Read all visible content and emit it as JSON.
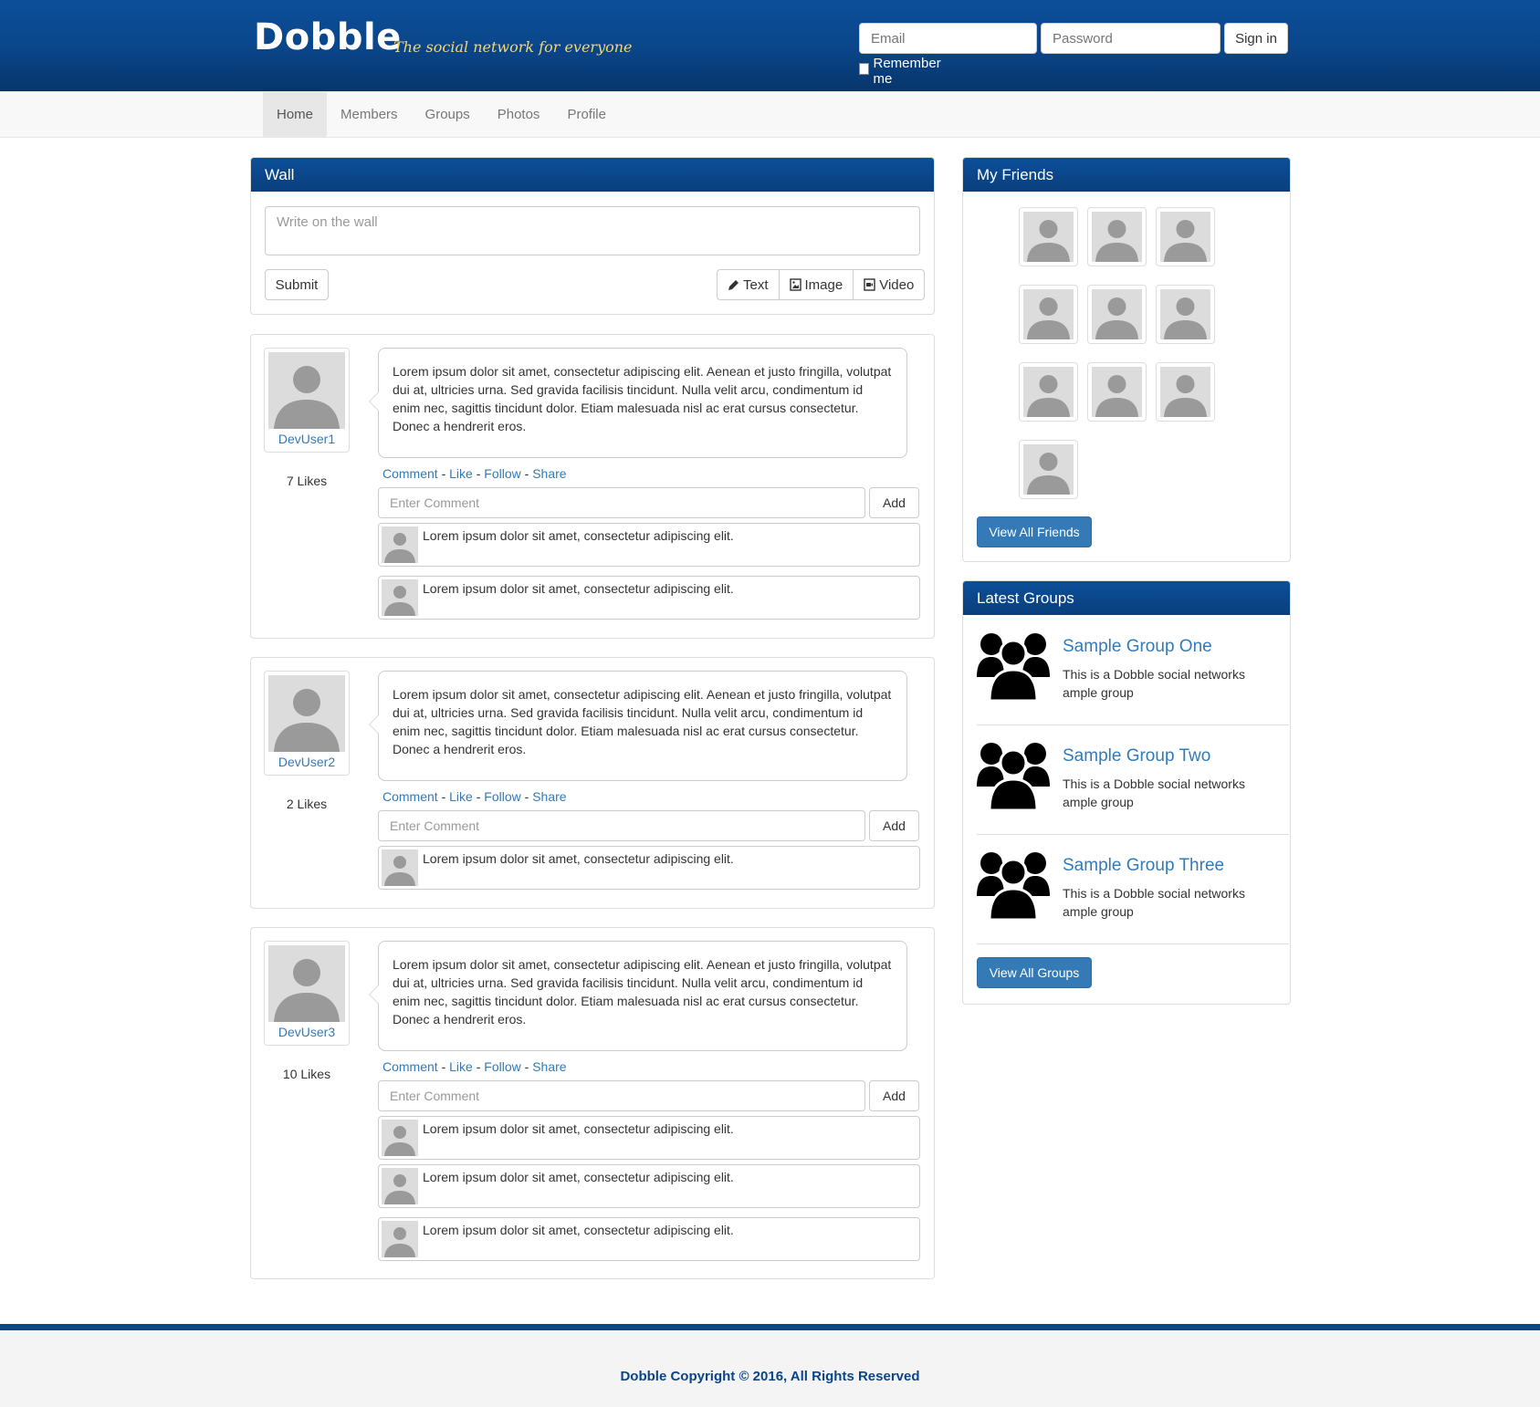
{
  "header": {
    "logo": "Dobble",
    "tagline": "The social network for everyone",
    "email_placeholder": "Email",
    "password_placeholder": "Password",
    "signin_label": "Sign in",
    "remember_label": "Remember me"
  },
  "nav": {
    "items": [
      {
        "label": "Home",
        "active": true
      },
      {
        "label": "Members"
      },
      {
        "label": "Groups"
      },
      {
        "label": "Photos"
      },
      {
        "label": "Profile"
      }
    ]
  },
  "wall": {
    "title": "Wall",
    "placeholder": "Write on the wall",
    "submit_label": "Submit",
    "type_buttons": [
      "Text",
      "Image",
      "Video"
    ]
  },
  "post_actions": [
    "Comment",
    "Like",
    "Follow",
    "Share"
  ],
  "comment_placeholder": "Enter Comment",
  "add_label": "Add",
  "posts": [
    {
      "user": "DevUser1",
      "likes": "7 Likes",
      "text": "Lorem ipsum dolor sit amet, consectetur adipiscing elit. Aenean et justo fringilla, volutpat dui at, ultricies urna. Sed gravida facilisis tincidunt. Nulla velit arcu, condimentum id enim nec, sagittis tincidunt dolor. Etiam malesuada nisl ac erat cursus consectetur. Donec a hendrerit eros.",
      "comments": [
        "Lorem ipsum dolor sit amet, consectetur adipiscing elit.",
        "Lorem ipsum dolor sit amet, consectetur adipiscing elit."
      ]
    },
    {
      "user": "DevUser2",
      "likes": "2 Likes",
      "text": "Lorem ipsum dolor sit amet, consectetur adipiscing elit. Aenean et justo fringilla, volutpat dui at, ultricies urna. Sed gravida facilisis tincidunt. Nulla velit arcu, condimentum id enim nec, sagittis tincidunt dolor. Etiam malesuada nisl ac erat cursus consectetur. Donec a hendrerit eros.",
      "comments": [
        "Lorem ipsum dolor sit amet, consectetur adipiscing elit."
      ]
    },
    {
      "user": "DevUser3",
      "likes": "10 Likes",
      "text": "Lorem ipsum dolor sit amet, consectetur adipiscing elit. Aenean et justo fringilla, volutpat dui at, ultricies urna. Sed gravida facilisis tincidunt. Nulla velit arcu, condimentum id enim nec, sagittis tincidunt dolor. Etiam malesuada nisl ac erat cursus consectetur. Donec a hendrerit eros.",
      "comments": [
        "Lorem ipsum dolor sit amet, consectetur adipiscing elit.",
        "Lorem ipsum dolor sit amet, consectetur adipiscing elit.",
        "Lorem ipsum dolor sit amet, consectetur adipiscing elit."
      ]
    }
  ],
  "friends": {
    "title": "My Friends",
    "view_all_label": "View All Friends"
  },
  "groups": {
    "title": "Latest Groups",
    "items": [
      {
        "name": "Sample Group One",
        "desc": "This is a Dobble social networks ample group"
      },
      {
        "name": "Sample Group Two",
        "desc": "This is a Dobble social networks ample group"
      },
      {
        "name": "Sample Group Three",
        "desc": "This is a Dobble social networks ample group"
      }
    ],
    "view_all_label": "View All Groups"
  },
  "footer": {
    "copyright": "Dobble Copyright © 2016, All Rights Reserved"
  },
  "colors": {
    "brand_blue": "#0a4589",
    "link_blue": "#337ab7",
    "tagline_gold": "#f3d57a"
  }
}
